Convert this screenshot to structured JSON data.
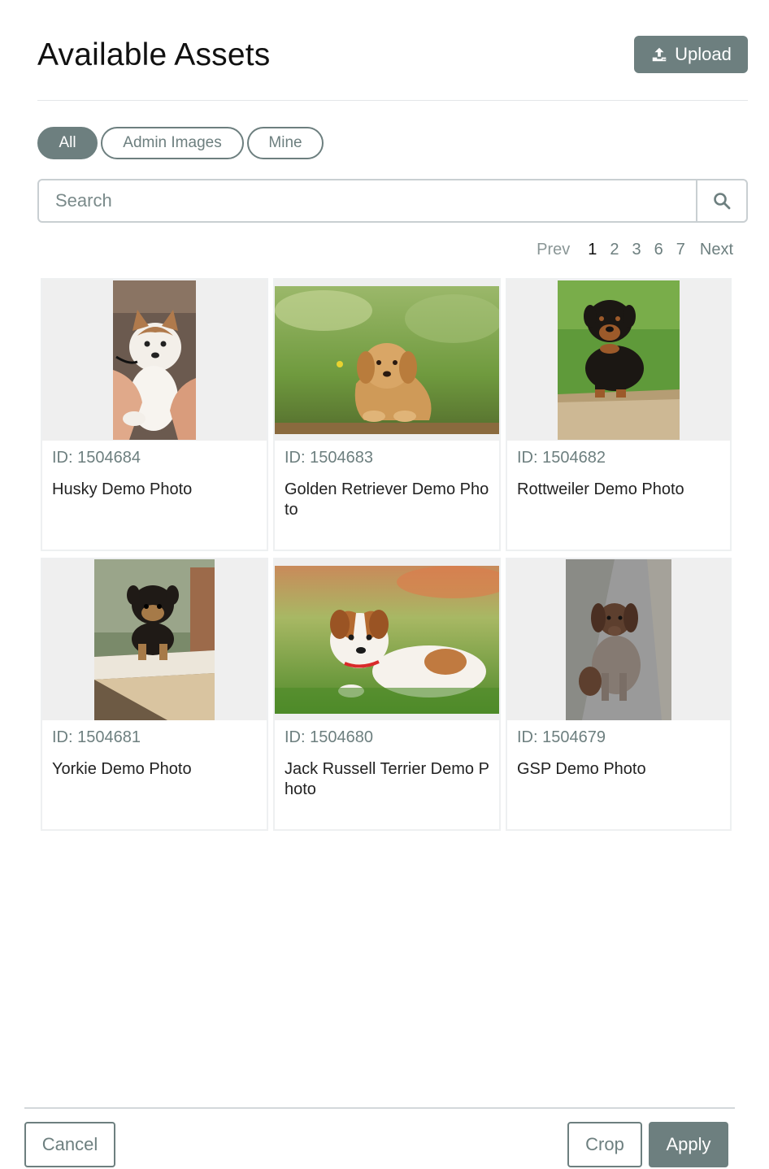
{
  "header": {
    "title": "Available Assets",
    "upload_label": "Upload"
  },
  "filters": [
    {
      "label": "All",
      "active": true
    },
    {
      "label": "Admin Images",
      "active": false
    },
    {
      "label": "Mine",
      "active": false
    }
  ],
  "search": {
    "placeholder": "Search"
  },
  "pagination": {
    "prev": "Prev",
    "pages": [
      "1",
      "2",
      "3",
      "6",
      "7"
    ],
    "current": "1",
    "next": "Next"
  },
  "assets": [
    {
      "id": "ID: 1504684",
      "name": "Husky Demo Photo"
    },
    {
      "id": "ID: 1504683",
      "name": "Golden Retriever Demo Photo"
    },
    {
      "id": "ID: 1504682",
      "name": "Rottweiler Demo Photo"
    },
    {
      "id": "ID: 1504681",
      "name": "Yorkie Demo Photo"
    },
    {
      "id": "ID: 1504680",
      "name": "Jack Russell Terrier Demo Photo"
    },
    {
      "id": "ID: 1504679",
      "name": "GSP Demo Photo"
    }
  ],
  "footer": {
    "cancel_label": "Cancel",
    "crop_label": "Crop",
    "apply_label": "Apply"
  },
  "colors": {
    "accent": "#6d7f7f",
    "border": "#c9cfd2",
    "thumb_bg": "#efefef"
  }
}
